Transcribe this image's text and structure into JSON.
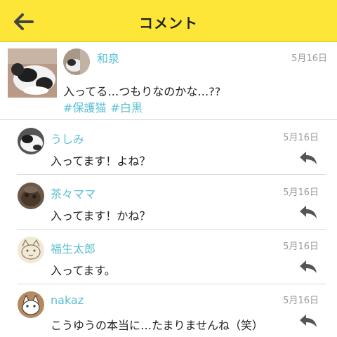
{
  "header": {
    "title": "コメント",
    "back_icon": "arrow-left-icon"
  },
  "post": {
    "author": "和泉",
    "date": "5月16日",
    "text": "入ってる…つもりなのかな…??",
    "tags": [
      "#保護猫",
      "#白黒"
    ]
  },
  "comments": [
    {
      "author": "うしみ",
      "date": "5月16日",
      "text": "入ってます！よね？",
      "reply_icon": "reply-arrow-icon"
    },
    {
      "author": "茶々ママ",
      "date": "5月16日",
      "text": "入ってます！かね？",
      "reply_icon": "reply-arrow-icon"
    },
    {
      "author": "福生太郎",
      "date": "5月16日",
      "text": "入ってます。",
      "reply_icon": "reply-arrow-icon"
    },
    {
      "author": "nakaz",
      "date": "5月16日",
      "text": "こうゆうの本当に…たまりませんね（笑）",
      "reply_icon": "reply-arrow-icon"
    }
  ],
  "colors": {
    "header_bg": "#fde637",
    "name": "#5bbfd2",
    "date": "#9a9a9a",
    "divider": "#dcdcdc",
    "icon": "#555555"
  }
}
